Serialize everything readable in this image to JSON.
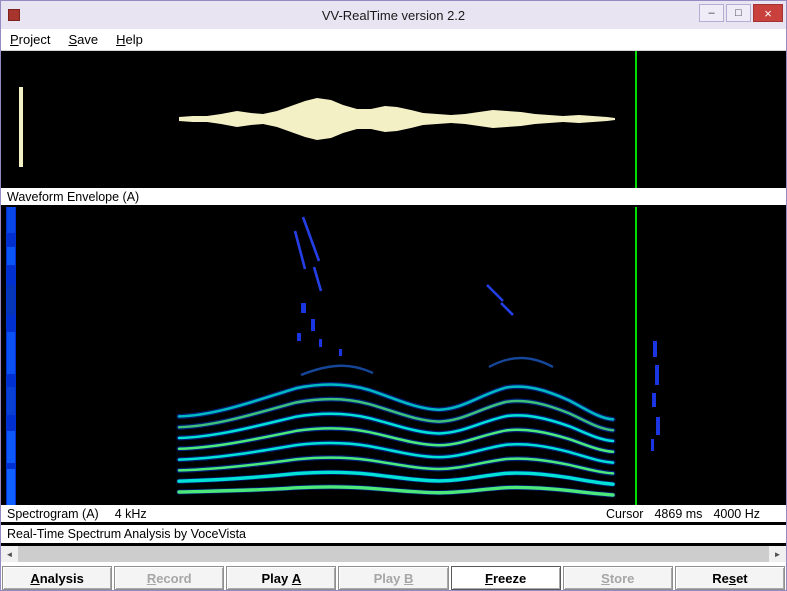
{
  "window": {
    "title": "VV-RealTime version 2.2",
    "minimize": "–",
    "maximize": "□",
    "close": "×"
  },
  "menu": [
    {
      "key": "P",
      "post": "roject"
    },
    {
      "key": "S",
      "post": "ave"
    },
    {
      "key": "H",
      "post": "elp"
    }
  ],
  "panels": {
    "waveform_label": "Waveform Envelope (A)",
    "spectrogram_label": "Spectrogram (A)",
    "freq_scale": "4 kHz",
    "cursor": {
      "label": "Cursor",
      "time": "4869 ms",
      "freq": "4000 Hz"
    },
    "status": "Real-Time Spectrum Analysis by VoceVista"
  },
  "buttons": [
    {
      "pre": "",
      "key": "A",
      "post": "nalysis"
    },
    {
      "pre": "",
      "key": "R",
      "post": "ecord"
    },
    {
      "pre": "Play ",
      "key": "A",
      "post": ""
    },
    {
      "pre": "Play ",
      "key": "B",
      "post": ""
    },
    {
      "pre": "",
      "key": "F",
      "post": "reeze"
    },
    {
      "pre": "",
      "key": "S",
      "post": "tore"
    },
    {
      "pre": "Re",
      "key": "s",
      "post": "et"
    }
  ],
  "scrollbar": {
    "left_arrow": "◄",
    "right_arrow": "►"
  },
  "colors": {
    "title_bar": "#e8e4f2",
    "close_button": "#c9413d",
    "cursor_line": "#00dc00",
    "waveform": "#f4f0c6",
    "band_blue": "#0030d0",
    "harmonic_cyan": "#00e2d6",
    "harmonic_green": "#4ce87a"
  },
  "viz": {
    "cursor_x_frac": 0.809,
    "harmonic_count": 8
  }
}
